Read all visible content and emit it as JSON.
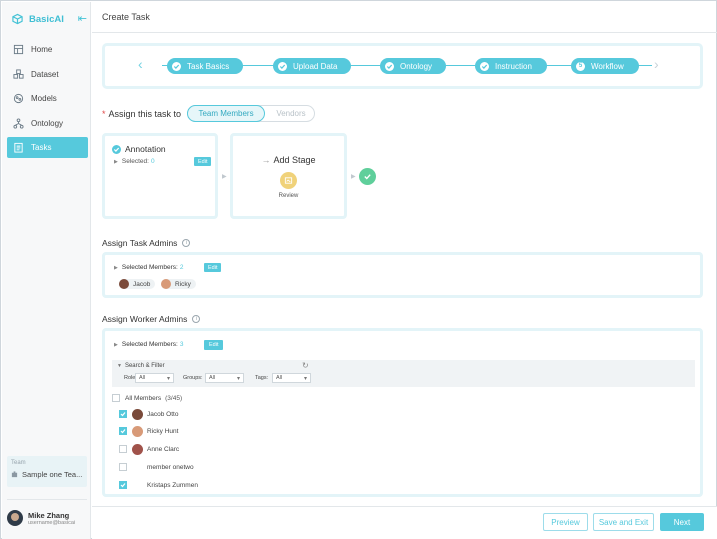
{
  "app": {
    "brand": "BasicAI",
    "page_title": "Create Task"
  },
  "sidebar": {
    "items": [
      {
        "label": "Home",
        "icon": "home-icon"
      },
      {
        "label": "Dataset",
        "icon": "dataset-icon"
      },
      {
        "label": "Models",
        "icon": "models-icon"
      },
      {
        "label": "Ontology",
        "icon": "ontology-icon"
      },
      {
        "label": "Tasks",
        "icon": "tasks-icon",
        "active": true
      }
    ],
    "team_label": "Team",
    "team_name": "Sample one Tea...",
    "user_name": "Mike Zhang",
    "user_email": "username@basicai"
  },
  "stepper": {
    "steps": [
      "Task Basics",
      "Upload Data",
      "Ontology",
      "Instruction",
      "Workflow"
    ],
    "current_step_number": "5"
  },
  "assign": {
    "label": "Assign this task to",
    "required_mark": "*",
    "options": [
      "Team Members",
      "Vendors"
    ],
    "selected": "Team Members"
  },
  "workflow": {
    "annotation_title": "Annotation",
    "selected_label": "Selected:",
    "selected_count": "0",
    "edit_label": "Edit",
    "add_stage_label": "Add Stage",
    "review_label": "Review"
  },
  "task_admins": {
    "title": "Assign Task Admins",
    "selected_label": "Selected Members:",
    "selected_count": "2",
    "edit_label": "Edit",
    "members": [
      "Jacob",
      "Ricky"
    ]
  },
  "worker_admins": {
    "title": "Assign Worker Admins",
    "selected_label": "Selected Members:",
    "selected_count": "3",
    "edit_label": "Edit",
    "filter_title": "Search & Filter",
    "filters": [
      {
        "label": "Roles:",
        "value": "All"
      },
      {
        "label": "Groups:",
        "value": "All"
      },
      {
        "label": "Tags:",
        "value": "All"
      }
    ],
    "all_members_label": "All Members",
    "all_members_count": "(3/45)",
    "members": [
      {
        "name": "Jacob Otto",
        "checked": true,
        "avatar": "jacob"
      },
      {
        "name": "Ricky Hunt",
        "checked": true,
        "avatar": "ricky"
      },
      {
        "name": "Anne Clarc",
        "checked": false,
        "avatar": "anne"
      },
      {
        "name": "member onetwo",
        "checked": false,
        "avatar": ""
      },
      {
        "name": "Kristaps Zummen",
        "checked": true,
        "avatar": ""
      }
    ]
  },
  "footer": {
    "preview": "Preview",
    "save_exit": "Save and Exit",
    "next": "Next"
  },
  "colors": {
    "accent": "#56c9dc",
    "success": "#5fcf9b",
    "review": "#f0d27a",
    "required": "#e04848"
  }
}
